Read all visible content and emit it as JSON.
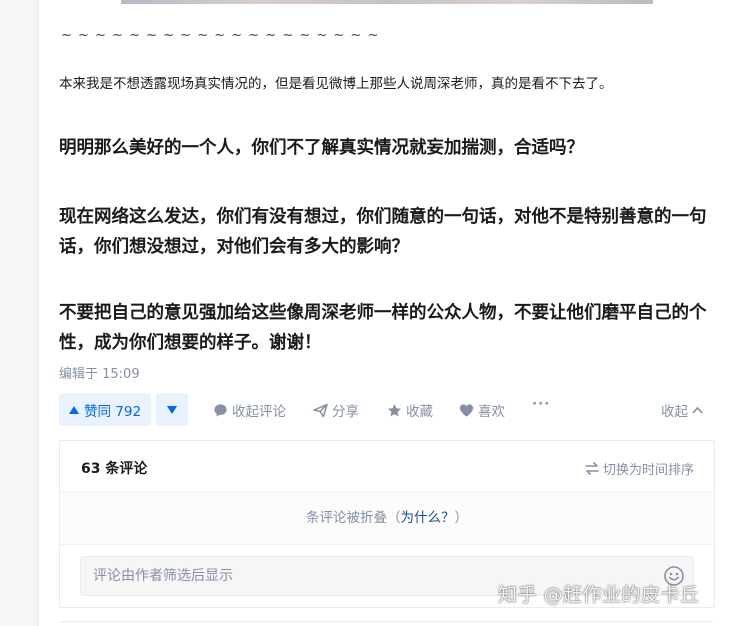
{
  "article": {
    "tilde_line": "~ ~ ~ ~ ~ ~ ~ ~ ~ ~ ~ ~ ~ ~ ~ ~ ~ ~ ~",
    "para_intro": "本来我是不想透露现场真实情况的，但是看见微博上那些人说周深老师，真的是看不下去了。",
    "para_1": "明明那么美好的一个人，你们不了解真实情况就妄加揣测，合适吗？",
    "para_2": "现在网络这么发达，你们有没有想过，你们随意的一句话，对他不是特别善意的一句话，你们想没想过，对他们会有多大的影响？",
    "para_3": "不要把自己的意见强加给这些像周深老师一样的公众人物，不要让他们磨平自己的个性，成为你们想要的样子。谢谢！",
    "edit_time": "编辑于 15:09"
  },
  "actions": {
    "vote_up_label": "赞同 792",
    "comment_label": "收起评论",
    "share_label": "分享",
    "collect_label": "收藏",
    "like_label": "喜欢",
    "more_label": "···",
    "collapse_label": "收起"
  },
  "comments": {
    "count_label": "63 条评论",
    "sort_label": "切换为时间排序",
    "folded_text": "条评论被折叠（",
    "folded_why": "为什么？",
    "folded_close": "）",
    "input_placeholder": "评论由作者筛选后显示"
  },
  "watermark": "知乎 @赶作业的皮卡丘",
  "colors": {
    "accent": "#0066ff",
    "accent_bg": "#eaf2ff",
    "muted": "#8590a6",
    "link": "#175199"
  },
  "icons": [
    "caret-up-icon",
    "caret-down-icon",
    "comment-icon",
    "share-icon",
    "star-icon",
    "heart-icon",
    "chevron-up-icon",
    "sort-icon",
    "emoji-icon"
  ]
}
